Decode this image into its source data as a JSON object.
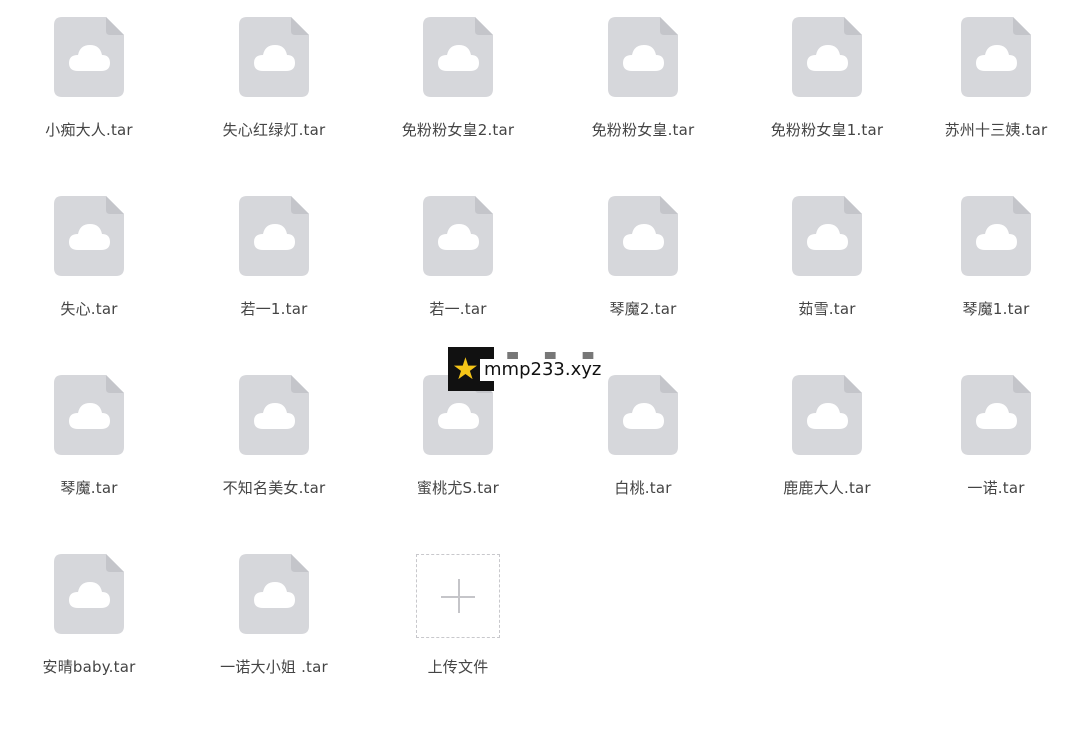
{
  "files": [
    {
      "name": "小痴大人.tar",
      "icon": "cloud-file-icon"
    },
    {
      "name": "失心红绿灯.tar",
      "icon": "cloud-file-icon"
    },
    {
      "name": "免粉粉女皇2.tar",
      "icon": "cloud-file-icon"
    },
    {
      "name": "免粉粉女皇.tar",
      "icon": "cloud-file-icon"
    },
    {
      "name": "免粉粉女皇1.tar",
      "icon": "cloud-file-icon"
    },
    {
      "name": "苏州十三姨.tar",
      "icon": "cloud-file-icon"
    },
    {
      "name": "失心.tar",
      "icon": "cloud-file-icon"
    },
    {
      "name": "若一1.tar",
      "icon": "cloud-file-icon"
    },
    {
      "name": "若一.tar",
      "icon": "cloud-file-icon"
    },
    {
      "name": "琴魔2.tar",
      "icon": "cloud-file-icon"
    },
    {
      "name": "茹雪.tar",
      "icon": "cloud-file-icon"
    },
    {
      "name": "琴魔1.tar",
      "icon": "cloud-file-icon"
    },
    {
      "name": "琴魔.tar",
      "icon": "cloud-file-icon"
    },
    {
      "name": "不知名美女.tar",
      "icon": "cloud-file-icon"
    },
    {
      "name": "蜜桃尤S.tar",
      "icon": "cloud-file-icon"
    },
    {
      "name": "白桃.tar",
      "icon": "cloud-file-icon"
    },
    {
      "name": "鹿鹿大人.tar",
      "icon": "cloud-file-icon"
    },
    {
      "name": "一诺.tar",
      "icon": "cloud-file-icon"
    },
    {
      "name": "安晴baby.tar",
      "icon": "cloud-file-icon"
    },
    {
      "name": "一诺大小姐 .tar",
      "icon": "cloud-file-icon"
    }
  ],
  "upload": {
    "label": "上传文件",
    "icon": "plus-icon"
  },
  "watermark": {
    "text": "mmp233.xyz"
  },
  "colors": {
    "icon_fill": "#d6d7db",
    "icon_cloud": "#ffffff",
    "text": "#444444"
  }
}
